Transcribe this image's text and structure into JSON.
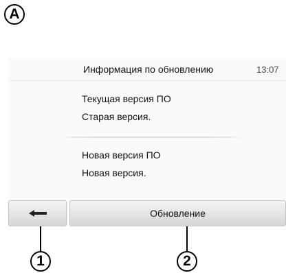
{
  "markers": {
    "a": "A",
    "one": "1",
    "two": "2"
  },
  "header": {
    "title": "Информация по обновлению",
    "time": "13:07"
  },
  "content": {
    "current_label": "Текущая версия ПО",
    "current_value": "Старая версия.",
    "new_label": "Новая версия ПО",
    "new_value": "Новая версия."
  },
  "footer": {
    "back_icon": "back-arrow-icon",
    "update_label": "Обновление"
  }
}
